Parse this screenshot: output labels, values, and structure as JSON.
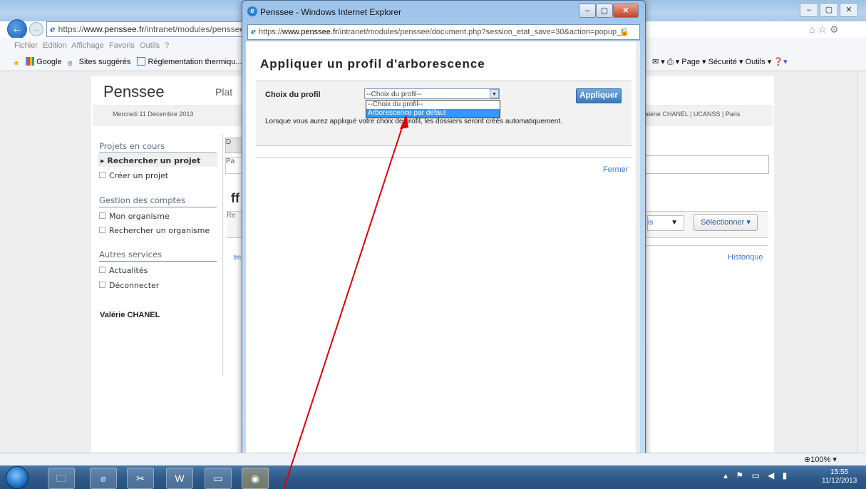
{
  "browser": {
    "address_url_prefix": "https://",
    "address_url_domain": "www.penssee.fr",
    "address_url_path": "/intranet/modules/penssee/d",
    "menu": "Fichier  Edition  Affichage  Favoris  Outils  ?",
    "favorites": [
      "Google",
      "Sites suggérés",
      "Réglementation thermiqu..."
    ],
    "commands": "Page ▾  Sécurité ▾  Outils ▾",
    "zoom": "100%"
  },
  "page": {
    "logo": "Penssee",
    "tagline_fragment": "Plat",
    "date": "Mercredi 11 Décembre 2013",
    "user_bar": "alérie CHANEL  |  UCANSS  |  Paris",
    "sidebar": {
      "section1": "Projets en cours",
      "item_search_project": "Rechercher un projet",
      "item_create_project": "Créer un projet",
      "section2": "Gestion des comptes",
      "item_my_org": "Mon organisme",
      "item_search_org": "Rechercher un organisme",
      "section3": "Autres services",
      "item_news": "Actualités",
      "item_logout": "Déconnecter",
      "user_name": "Valérie CHANEL"
    },
    "fragments": {
      "tab": "D",
      "pa": "Pa",
      "ff": "ff",
      "re": "Re",
      "im": "Im",
      "is": "is"
    },
    "select_button": "Sélectionner ▾",
    "history_link": "Historique"
  },
  "popup": {
    "window_title": "Penssee - Windows Internet Explorer",
    "address_prefix": "https://",
    "address_domain": "www.penssee.fr",
    "address_path": "/intranet/modules/penssee/document.php?session_etat_save=30&action=popup_t",
    "heading": "Appliquer un profil d'arborescence",
    "profile_label": "Choix du profil",
    "select_value": "--Choix du profil--",
    "options": [
      "--Choix du profil--",
      "Arborescence par défaut"
    ],
    "apply_button": "Appliquer",
    "info_text": "Lorsque vous aurez appliqué votre choix de profil, les dossiers seront créés automatiquement.",
    "close_link": "Fermer"
  },
  "taskbar": {
    "time": "15:55",
    "date": "11/12/2013"
  },
  "colors": {
    "link": "#3b79c9",
    "apply_button": "#3a78bb",
    "highlight_option": "#3399ff",
    "arrow": "#e00000"
  }
}
